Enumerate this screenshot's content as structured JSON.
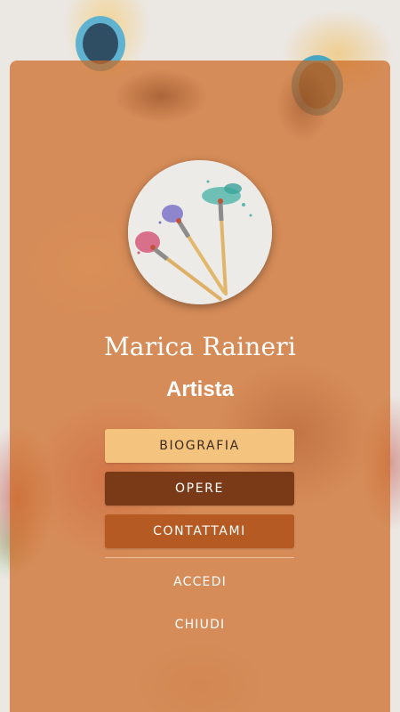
{
  "profile": {
    "name": "Marica Raineri",
    "role": "Artista",
    "avatar_icon": "paintbrushes-watercolor-icon"
  },
  "menu": {
    "buttons": [
      {
        "label": "BIOGRAFIA"
      },
      {
        "label": "OPERE"
      },
      {
        "label": "CONTATTAMI"
      }
    ],
    "links": [
      {
        "label": "ACCEDI"
      },
      {
        "label": "CHIUDI"
      }
    ]
  },
  "colors": {
    "card_overlay": "#cd6923",
    "biografia_bg": "#f4c47e",
    "opere_bg": "#7a3a18",
    "contattami_bg": "#b55a22",
    "text_light": "#ffffff"
  }
}
